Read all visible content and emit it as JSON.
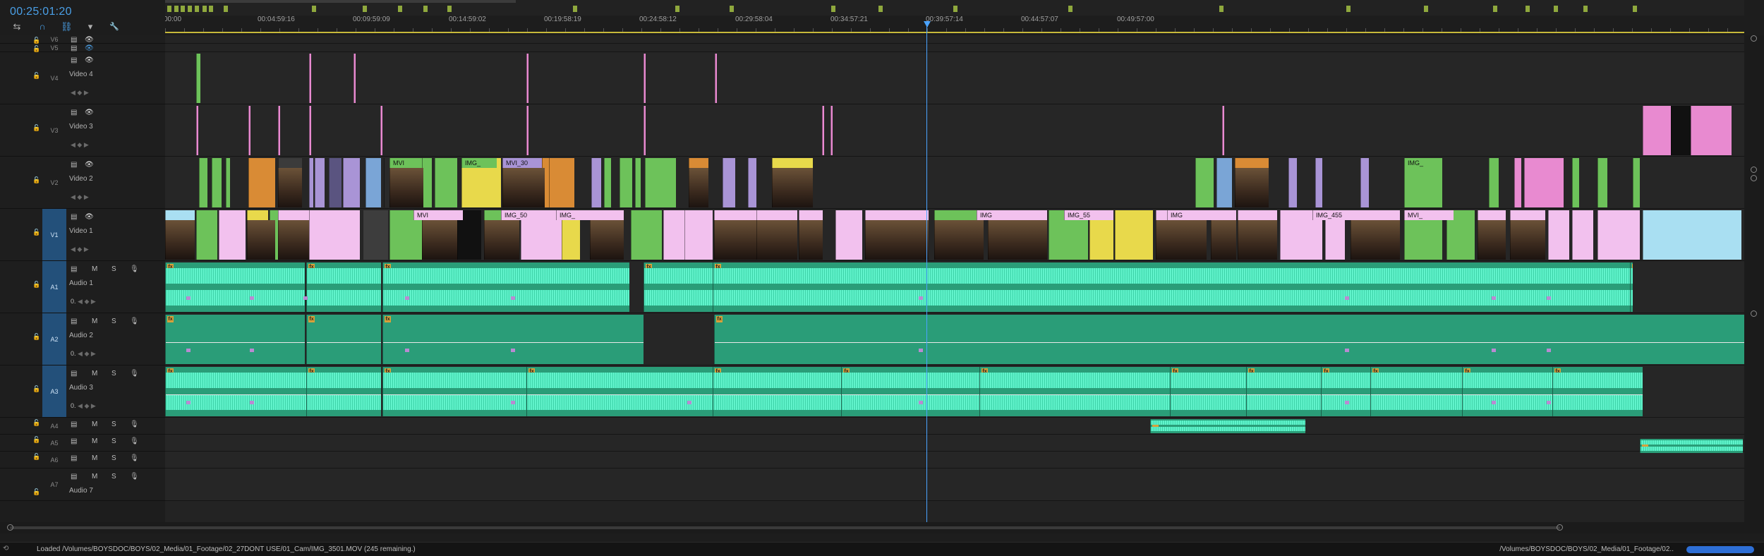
{
  "sequence": {
    "timecode": "00:25:01:20"
  },
  "toolbar": {
    "tools": [
      {
        "name": "insert-overwrite",
        "glyph": "⇆"
      },
      {
        "name": "snap",
        "glyph": "∩"
      },
      {
        "name": "linked-selection",
        "glyph": "⛓"
      },
      {
        "name": "add-marker",
        "glyph": "▾"
      },
      {
        "name": "settings",
        "glyph": "🔧"
      }
    ]
  },
  "ruler": {
    "labels": [
      "00:00",
      "00:04:59:16",
      "00:09:59:09",
      "00:14:59:02",
      "00:19:58:19",
      "00:24:58:12",
      "00:29:58:04",
      "00:34:57:21",
      "00:39:57:14",
      "00:44:57:07",
      "00:49:57:00"
    ],
    "playhead_label": "00:24:58:12"
  },
  "tracks": {
    "video": [
      {
        "id": "V6",
        "name": ""
      },
      {
        "id": "V5",
        "name": ""
      },
      {
        "id": "V4",
        "name": "Video 4"
      },
      {
        "id": "V3",
        "name": "Video 3"
      },
      {
        "id": "V2",
        "name": "Video 2"
      },
      {
        "id": "V1",
        "name": "Video 1"
      }
    ],
    "audio": [
      {
        "id": "A1",
        "name": "Audio 1"
      },
      {
        "id": "A2",
        "name": "Audio 2"
      },
      {
        "id": "A3",
        "name": "Audio 3"
      },
      {
        "id": "A4",
        "name": ""
      },
      {
        "id": "A5",
        "name": ""
      },
      {
        "id": "A6",
        "name": ""
      },
      {
        "id": "A7",
        "name": "Audio 7"
      }
    ],
    "controls": {
      "mute": "M",
      "solo": "S",
      "keyframe_value": "0."
    }
  },
  "clip_labels": {
    "v2": [
      "MVI",
      "IMG_",
      "MVI_30",
      "IMG_"
    ],
    "v1": [
      "MVI",
      "IMG_50",
      "IMG_",
      "IMG",
      "IMG_55",
      "IMG",
      "IMG_455",
      "MVI_"
    ]
  },
  "status": {
    "left": "Loaded /Volumes/BOYSDOC/BOYS/02_Media/01_Footage/02_27DONT USE/01_Cam/IMG_3501.MOV (245 remaining.)",
    "right": "/Volumes/BOYSDOC/BOYS/02_Media/01_Footage/02.."
  },
  "colors": {
    "accent": "#4a9fe6",
    "audio_clip": "#2a9d78",
    "waveform": "#59f0c6",
    "green_clip": "#6dc25a",
    "orange_clip": "#d98b35",
    "yellow_clip": "#e8d94b",
    "lavender_clip": "#a994d6",
    "pink_clip": "#e88ad0",
    "light_pink_clip": "#f2c1ee",
    "blue_clip": "#7aa5d6",
    "cyan_clip": "#a9dff2"
  }
}
